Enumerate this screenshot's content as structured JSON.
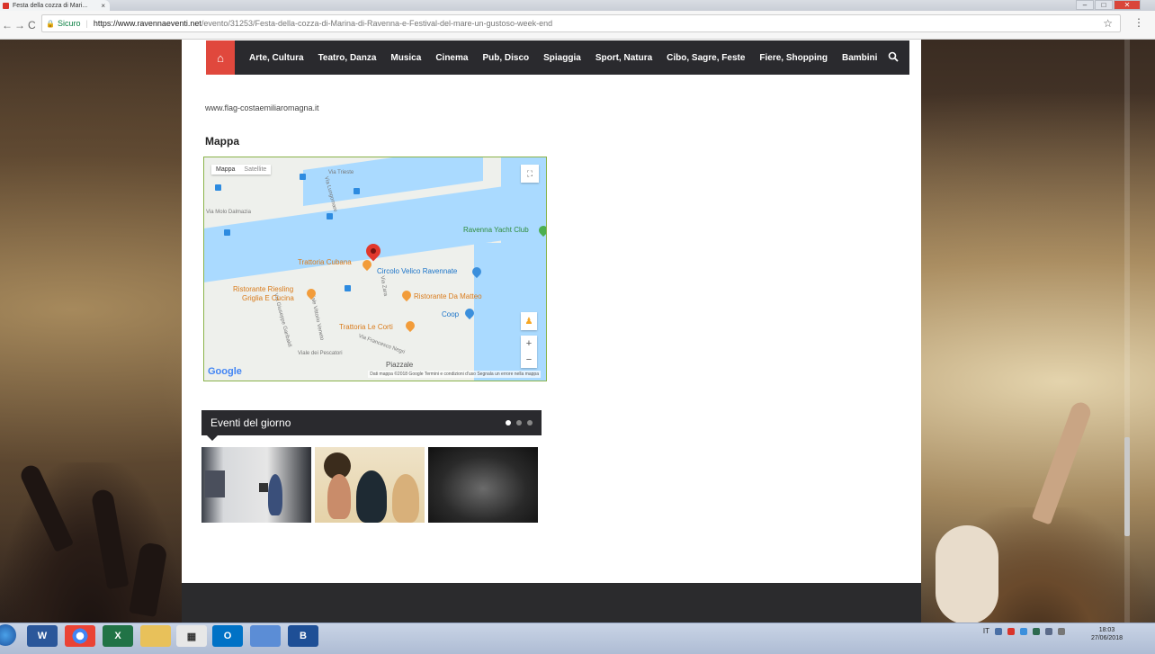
{
  "browser": {
    "tab_title": "Festa della cozza di Mari...",
    "tab_close": "×",
    "window_buttons": [
      "–",
      "□",
      "✕"
    ],
    "back": "←",
    "forward": "→",
    "reload": "C",
    "secure_label": "Sicuro",
    "url_host": "https://www.ravennaeventi.net",
    "url_path": "/evento/31253/Festa-della-cozza-di-Marina-di-Ravenna-e-Festival-del-mare-un-gustoso-week-end",
    "star": "☆",
    "menu": "⋮"
  },
  "nav": {
    "home_icon": "⌂",
    "items": [
      "Arte, Cultura",
      "Teatro, Danza",
      "Musica",
      "Cinema",
      "Pub, Disco",
      "Spiaggia",
      "Sport, Natura",
      "Cibo, Sagre, Feste",
      "Fiere, Shopping",
      "Bambini"
    ],
    "search_icon": "🔍"
  },
  "content": {
    "website_link": "www.flag-costaemiliaromagna.it",
    "map_section_title": "Mappa"
  },
  "map": {
    "tab_map": "Mappa",
    "tab_satellite": "Satellite",
    "fullscreen_icon": "⛶",
    "zoom_in": "+",
    "zoom_out": "−",
    "pegman_icon": "♟",
    "google_logo": "Google",
    "footer": "Dati mappa ©2018 Google   Termini e condizioni d'uso   Segnala un errore nella mappa",
    "labels": {
      "yacht_club": "Ravenna Yacht Club",
      "trattoria_cubana": "Trattoria Cubana",
      "circolo_velico": "Circolo Velico Ravennate",
      "riesling": "Ristorante Riesling",
      "griglia": "Griglia E Cucina",
      "da_matteo": "Ristorante Da Matteo",
      "coop": "Coop",
      "le_corti": "Trattoria Le Corti",
      "piazzale": "Piazzale"
    },
    "street_labels": [
      "Via Molo Dalmazia",
      "Via Lungomare",
      "Via Zara",
      "Via Trieste",
      "Via Giuseppe Garibaldi",
      "Viale dei Pescatori",
      "Viale Vittorio Veneto",
      "Via Francesco Negri"
    ]
  },
  "events": {
    "title": "Eventi del giorno",
    "pager_dots": 3,
    "active_dot": 0
  },
  "taskbar": {
    "apps": [
      "W",
      "",
      "X",
      "",
      "",
      "O",
      "",
      "B"
    ],
    "language": "IT",
    "time": "18:03",
    "date": "27/06/2018"
  }
}
